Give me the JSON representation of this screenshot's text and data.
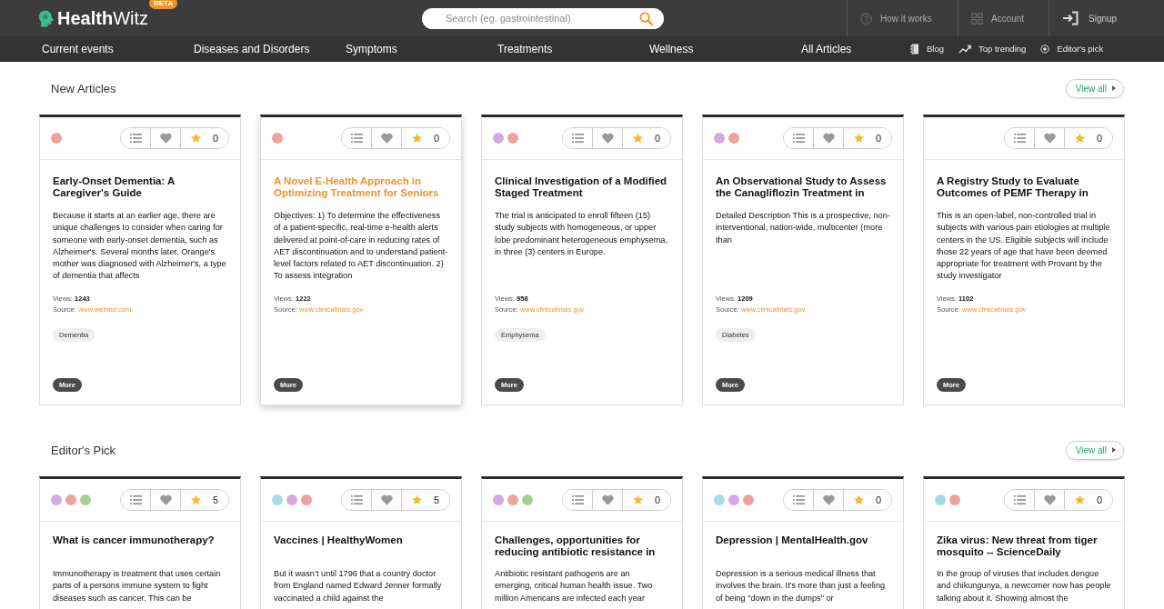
{
  "header": {
    "logo": "**Health**Witz",
    "badge": "BETA",
    "search": {
      "placeholder": "Search (eg. gastrointestinal)"
    },
    "links": [
      {
        "kind": "help",
        "label": "How it works"
      },
      {
        "kind": "grid",
        "label": "Account"
      },
      {
        "kind": "signin",
        "label": "Signup"
      }
    ]
  },
  "nav": {
    "items": [
      "Current events",
      "Diseases and Disorders",
      "Symptoms",
      "Treatments",
      "Wellness",
      "All Articles"
    ],
    "side": [
      {
        "kind": "notebook",
        "label": "Blog"
      },
      {
        "kind": "trend",
        "label": "Top trending"
      },
      {
        "kind": "target",
        "label": "Editor's pick"
      }
    ]
  },
  "sections": [
    {
      "title": "New Articles",
      "view_all": "View all",
      "cards": [
        {
          "dots": [
            {
              "color": "#eca39d"
            }
          ],
          "count": "0",
          "title": "Early-Onset Dementia: A Caregiver's Guide",
          "highlighted": false,
          "body": "Because it starts at an earlier age, there are unique challenges to consider when caring for someone with early-onset dementia, such as Alzheimer's. Several months later, Orange's mother was diagnosed with Alzheimer's, a type of dementia that affects",
          "views_label": "Views:",
          "views": "1243",
          "source_label": "Source:",
          "source": "www.webmd.com",
          "tag": "Dementia",
          "more": "More"
        },
        {
          "dots": [
            {
              "color": "#eca39d"
            }
          ],
          "count": "0",
          "title": "A Novel E-Health Approach in Optimizing Treatment for Seniors",
          "highlighted": true,
          "body": "Objectives: 1) To determine the effectiveness of a patient-specific, real-time e-health alerts delivered at point-of-care in reducing rates of AET discontinuation and to understand patient-level factors related to AET discontinuation. 2) To assess integration",
          "views_label": "Views:",
          "views": "1222",
          "source_label": "Source:",
          "source": "www.clinicaltrials.gov",
          "more": "More"
        },
        {
          "dots": [
            {
              "color": "#d4a9e3"
            },
            {
              "color": "#eca39d"
            }
          ],
          "count": "0",
          "title": "Clinical Investigation of a Modified Staged Treatment",
          "highlighted": false,
          "body": "The trial is anticipated to enroll fifteen (15) study subjects with homogeneous, or upper lobe predominant heterogeneous emphysema, in three (3) centers in Europe.",
          "views_label": "Views:",
          "views": "958",
          "source_label": "Source:",
          "source": "www.clinicaltrials.gov",
          "tag": "Emphysema",
          "more": "More"
        },
        {
          "dots": [
            {
              "color": "#d4a9e3"
            },
            {
              "color": "#eca39d"
            }
          ],
          "count": "0",
          "title": "An Observational Study to Assess the Canagliflozin Treatment in",
          "highlighted": false,
          "body": "Detailed Description This is a prospective, non-interventional, nation-wide, multicenter (more than",
          "views_label": "Views:",
          "views": "1209",
          "source_label": "Source:",
          "source": "www.clinicaltrials.gov",
          "tag": "Diabetes",
          "more": "More"
        },
        {
          "count": "0",
          "title": "A Registry Study to Evaluate Outcomes of PEMF Therapy in",
          "highlighted": false,
          "body": "This is an open-label, non-controlled trial in subjects with various pain etiologies at multiple centers in the US. Eligible subjects will include those 22 years of age that have been deemed appropriate for treatment with Provant by the study investigator",
          "views_label": "Views:",
          "views": "1102",
          "source_label": "Source:",
          "source": "www.clinicaltrials.gov",
          "more": "More"
        }
      ]
    },
    {
      "title": "Editor's Pick",
      "view_all": "View all",
      "cards": [
        {
          "dots": [
            {
              "color": "#d4a9e3"
            },
            {
              "color": "#eca39d"
            },
            {
              "color": "#a9cf97"
            }
          ],
          "count": "5",
          "title": "What is cancer immunotherapy?",
          "highlighted": false,
          "body": "Immunotherapy is treatment that uses certain parts of a persons immune system to fight diseases such as cancer. This can be"
        },
        {
          "dots": [
            {
              "color": "#a7dbe8"
            },
            {
              "color": "#d4a9e3"
            },
            {
              "color": "#eca39d"
            }
          ],
          "count": "5",
          "title": "Vaccines | HealthyWomen",
          "highlighted": false,
          "body": "But it wasn’t until 1796 that a country doctor from England named Edward Jenner formally vaccinated a child against the"
        },
        {
          "dots": [
            {
              "color": "#d4a9e3"
            },
            {
              "color": "#eca39d"
            },
            {
              "color": "#a9cf97"
            }
          ],
          "count": "0",
          "title": "Challenges, opportunities for reducing antibiotic resistance in",
          "highlighted": false,
          "body": "Antibiotic resistant pathogens are an emerging, critical human health issue. Two million Americans are infected each year"
        },
        {
          "dots": [
            {
              "color": "#a7dbe8"
            },
            {
              "color": "#d4a9e3"
            },
            {
              "color": "#eca39d"
            }
          ],
          "count": "0",
          "title": "Depression | MentalHealth.gov",
          "highlighted": false,
          "body": "Depression is a serious medical illness that involves the brain. It's more than just a feeling of being \"down in the dumps\" or"
        },
        {
          "dots": [
            {
              "color": "#a7dbe8"
            },
            {
              "color": "#eca39d"
            }
          ],
          "count": "0",
          "title": "Zika virus: New threat from tiger mosquito -- ScienceDaily",
          "highlighted": false,
          "body": "In the group of viruses that includes dengue and chikungunya, a newcomer now has people talking about it. Showing almost the"
        }
      ]
    }
  ]
}
